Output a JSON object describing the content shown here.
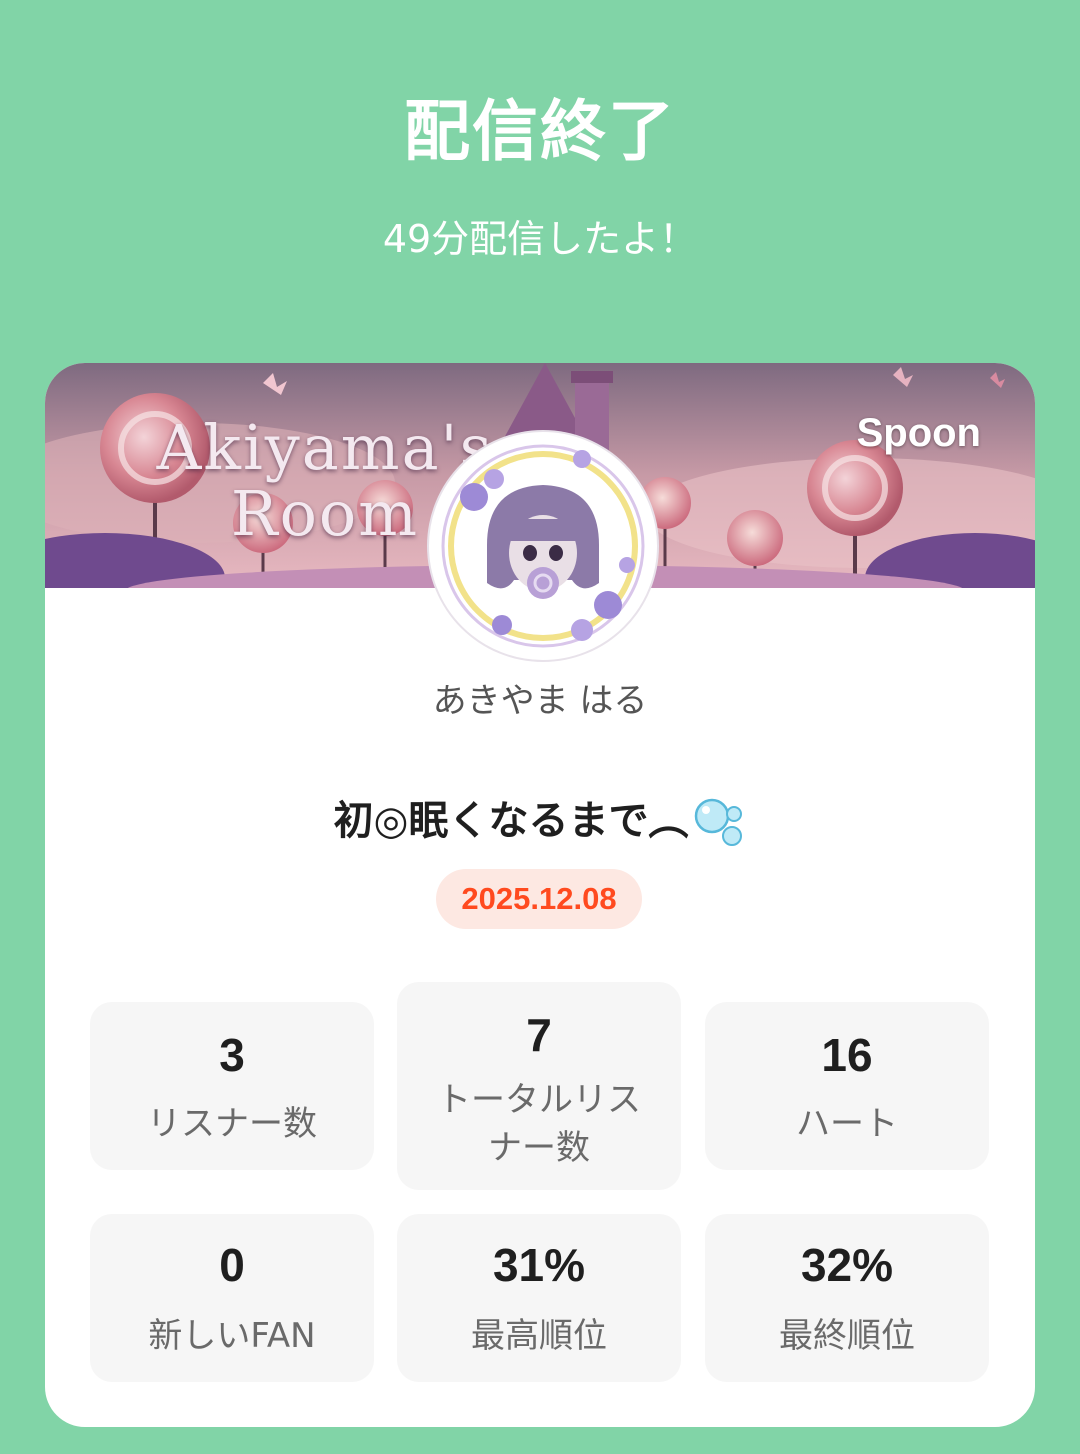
{
  "header": {
    "title": "配信終了",
    "subtitle": "49分配信したよ！"
  },
  "banner": {
    "line1": "Akiyama's",
    "line2": "Room",
    "brand": "Spoon"
  },
  "profile": {
    "username": "あきやま はる"
  },
  "broadcast": {
    "title": "初◎眠くなるまで︵",
    "date": "2025.12.08"
  },
  "stats": [
    {
      "value": "3",
      "label": "リスナー数"
    },
    {
      "value": "7",
      "label": "トータルリスナー数"
    },
    {
      "value": "16",
      "label": "ハート"
    },
    {
      "value": "0",
      "label": "新しいFAN"
    },
    {
      "value": "31%",
      "label": "最高順位"
    },
    {
      "value": "32%",
      "label": "最終順位"
    }
  ],
  "colors": {
    "background": "#81d4a7",
    "card": "#ffffff",
    "stat_box": "#f6f6f6",
    "date_badge_bg": "#fde8e2",
    "date_text": "#ff4a1f"
  }
}
